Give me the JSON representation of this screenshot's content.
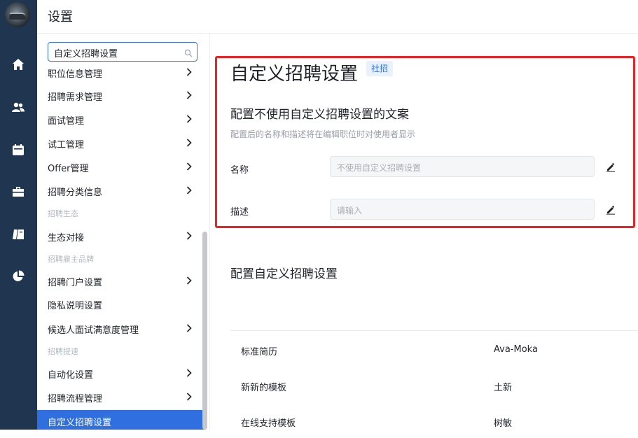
{
  "header": {
    "title": "设置"
  },
  "sidebar": {
    "search_value": "自定义招聘设置",
    "items": [
      {
        "label": "职位信息管理",
        "chevron": true
      },
      {
        "label": "招聘需求管理",
        "chevron": true
      },
      {
        "label": "面试管理",
        "chevron": true
      },
      {
        "label": "试工管理",
        "chevron": true
      },
      {
        "label": "Offer管理",
        "chevron": true
      },
      {
        "label": "招聘分类信息",
        "chevron": true
      },
      {
        "label": "生态对接",
        "chevron": true
      },
      {
        "label": "招聘门户设置",
        "chevron": true
      },
      {
        "label": "隐私说明设置",
        "chevron": false
      },
      {
        "label": "候选人面试满意度管理",
        "chevron": true
      },
      {
        "label": "自动化设置",
        "chevron": true
      },
      {
        "label": "招聘流程管理",
        "chevron": true
      },
      {
        "label": "自定义招聘设置",
        "chevron": false,
        "active": true
      }
    ],
    "groups": [
      "招聘生态",
      "招聘雇主品牌",
      "招聘提速"
    ]
  },
  "main": {
    "page_title": "自定义招聘设置",
    "tag": "社招",
    "section1": {
      "title": "配置不使用自定义招聘设置的文案",
      "description": "配置后的名称和描述将在编辑职位时对使用者显示",
      "name_label": "名称",
      "name_placeholder": "不使用自定义招聘设置",
      "desc_label": "描述",
      "desc_placeholder": "请输入"
    },
    "section2": {
      "title": "配置自定义招聘设置",
      "rows": [
        {
          "name": "标准简历",
          "value": "Ava-Moka"
        },
        {
          "name": "新新的模板",
          "value": "土新"
        },
        {
          "name": "在线支持模板",
          "value": "树敏"
        }
      ]
    }
  },
  "colors": {
    "rail": "#1f3550",
    "accent": "#2f6fe0",
    "highlight": "#ee2222"
  },
  "icons": {
    "rail": [
      "home-icon",
      "users-icon",
      "calendar-icon",
      "briefcase-icon",
      "book-icon",
      "pie-chart-icon"
    ]
  }
}
